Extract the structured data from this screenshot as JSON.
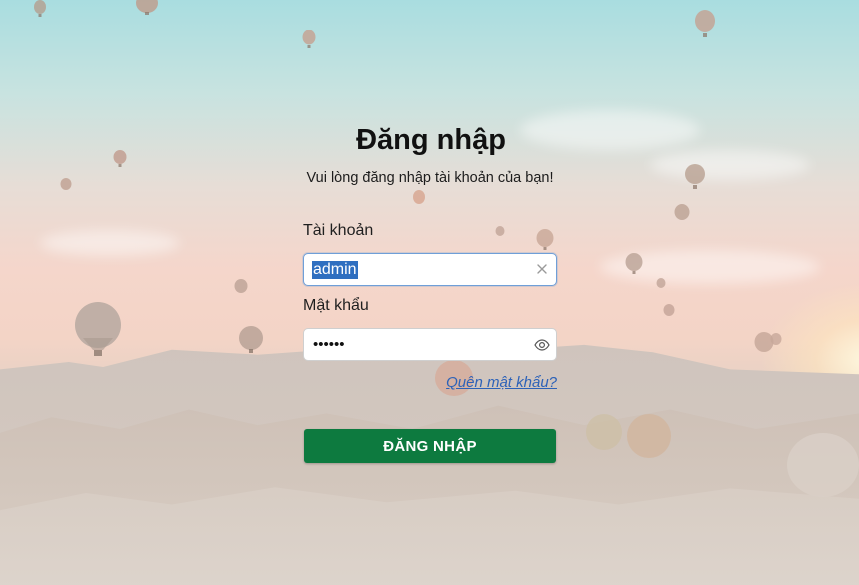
{
  "login": {
    "title": "Đăng nhập",
    "subtitle": "Vui lòng đăng nhập tài khoản của bạn!",
    "username_label": "Tài khoản",
    "username_value": "admin",
    "password_label": "Mật khẩu",
    "password_masked": "••••••",
    "forgot_password": "Quên mật khẩu?",
    "submit_label": "ĐĂNG NHẬP"
  },
  "icons": {
    "clear": "close-icon",
    "toggle_password": "eye-icon"
  },
  "colors": {
    "primary_button": "#0d7a3f",
    "link": "#2d62b8",
    "input_focus_border": "#6f9fd8",
    "selection": "#2f6fc0"
  }
}
